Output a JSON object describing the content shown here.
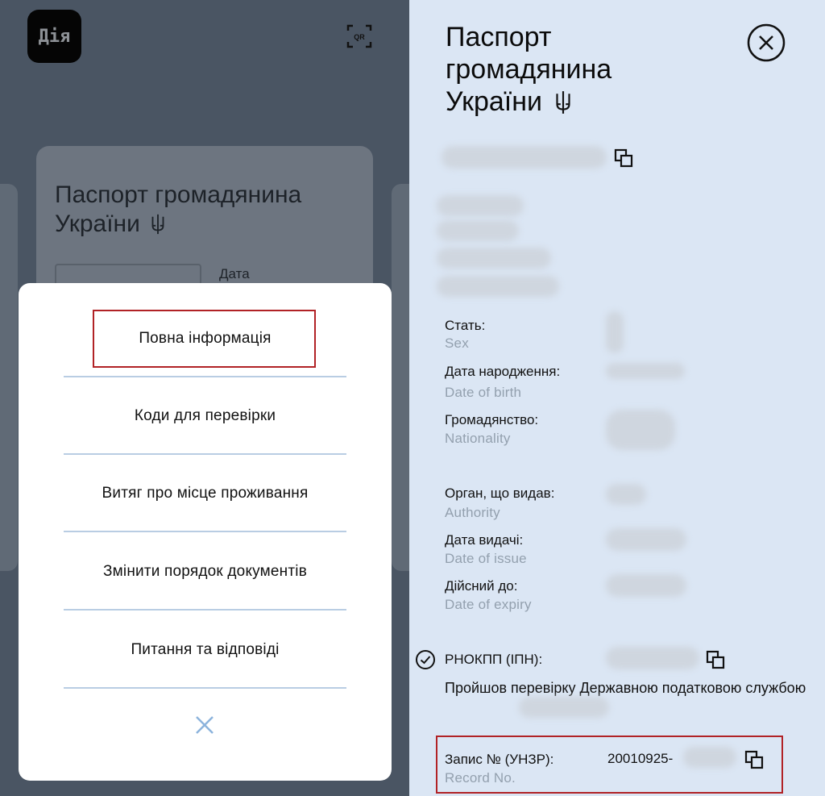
{
  "app": {
    "logo_text": "Дія",
    "qr_label": "QR"
  },
  "card": {
    "title": "Паспорт громадянина України",
    "date_label": "Дата"
  },
  "menu": {
    "items": [
      {
        "label": "Повна інформація"
      },
      {
        "label": "Коди для перевірки"
      },
      {
        "label": "Витяг про місце проживання"
      },
      {
        "label": "Змінити порядок документів"
      },
      {
        "label": "Питання та відповіді"
      }
    ]
  },
  "panel": {
    "title": "Паспорт громадянина України",
    "fields": [
      {
        "label": "Стать:",
        "sub": "Sex"
      },
      {
        "label": "Дата народження:",
        "sub": "Date of birth"
      },
      {
        "label": "Громадянство:",
        "sub": "Nationality"
      },
      {
        "label": "Орган, що видав:",
        "sub": "Authority"
      },
      {
        "label": "Дата видачі:",
        "sub": "Date of issue"
      },
      {
        "label": "Дійсний до:",
        "sub": "Date of expiry"
      }
    ],
    "tax_label": "РНОКПП (ІПН):",
    "tax_note": "Пройшов перевірку Державною податковою службою",
    "record_label": "Запис № (УНЗР):",
    "record_sub": "Record No.",
    "record_value": "20010925-"
  },
  "colors": {
    "highlight": "#b12226",
    "divider": "#b9cde3",
    "panel_bg": "#dbe6f4"
  },
  "icons": [
    "qr-icon",
    "trident-icon",
    "close-icon",
    "copy-icon",
    "check-circle-icon"
  ]
}
